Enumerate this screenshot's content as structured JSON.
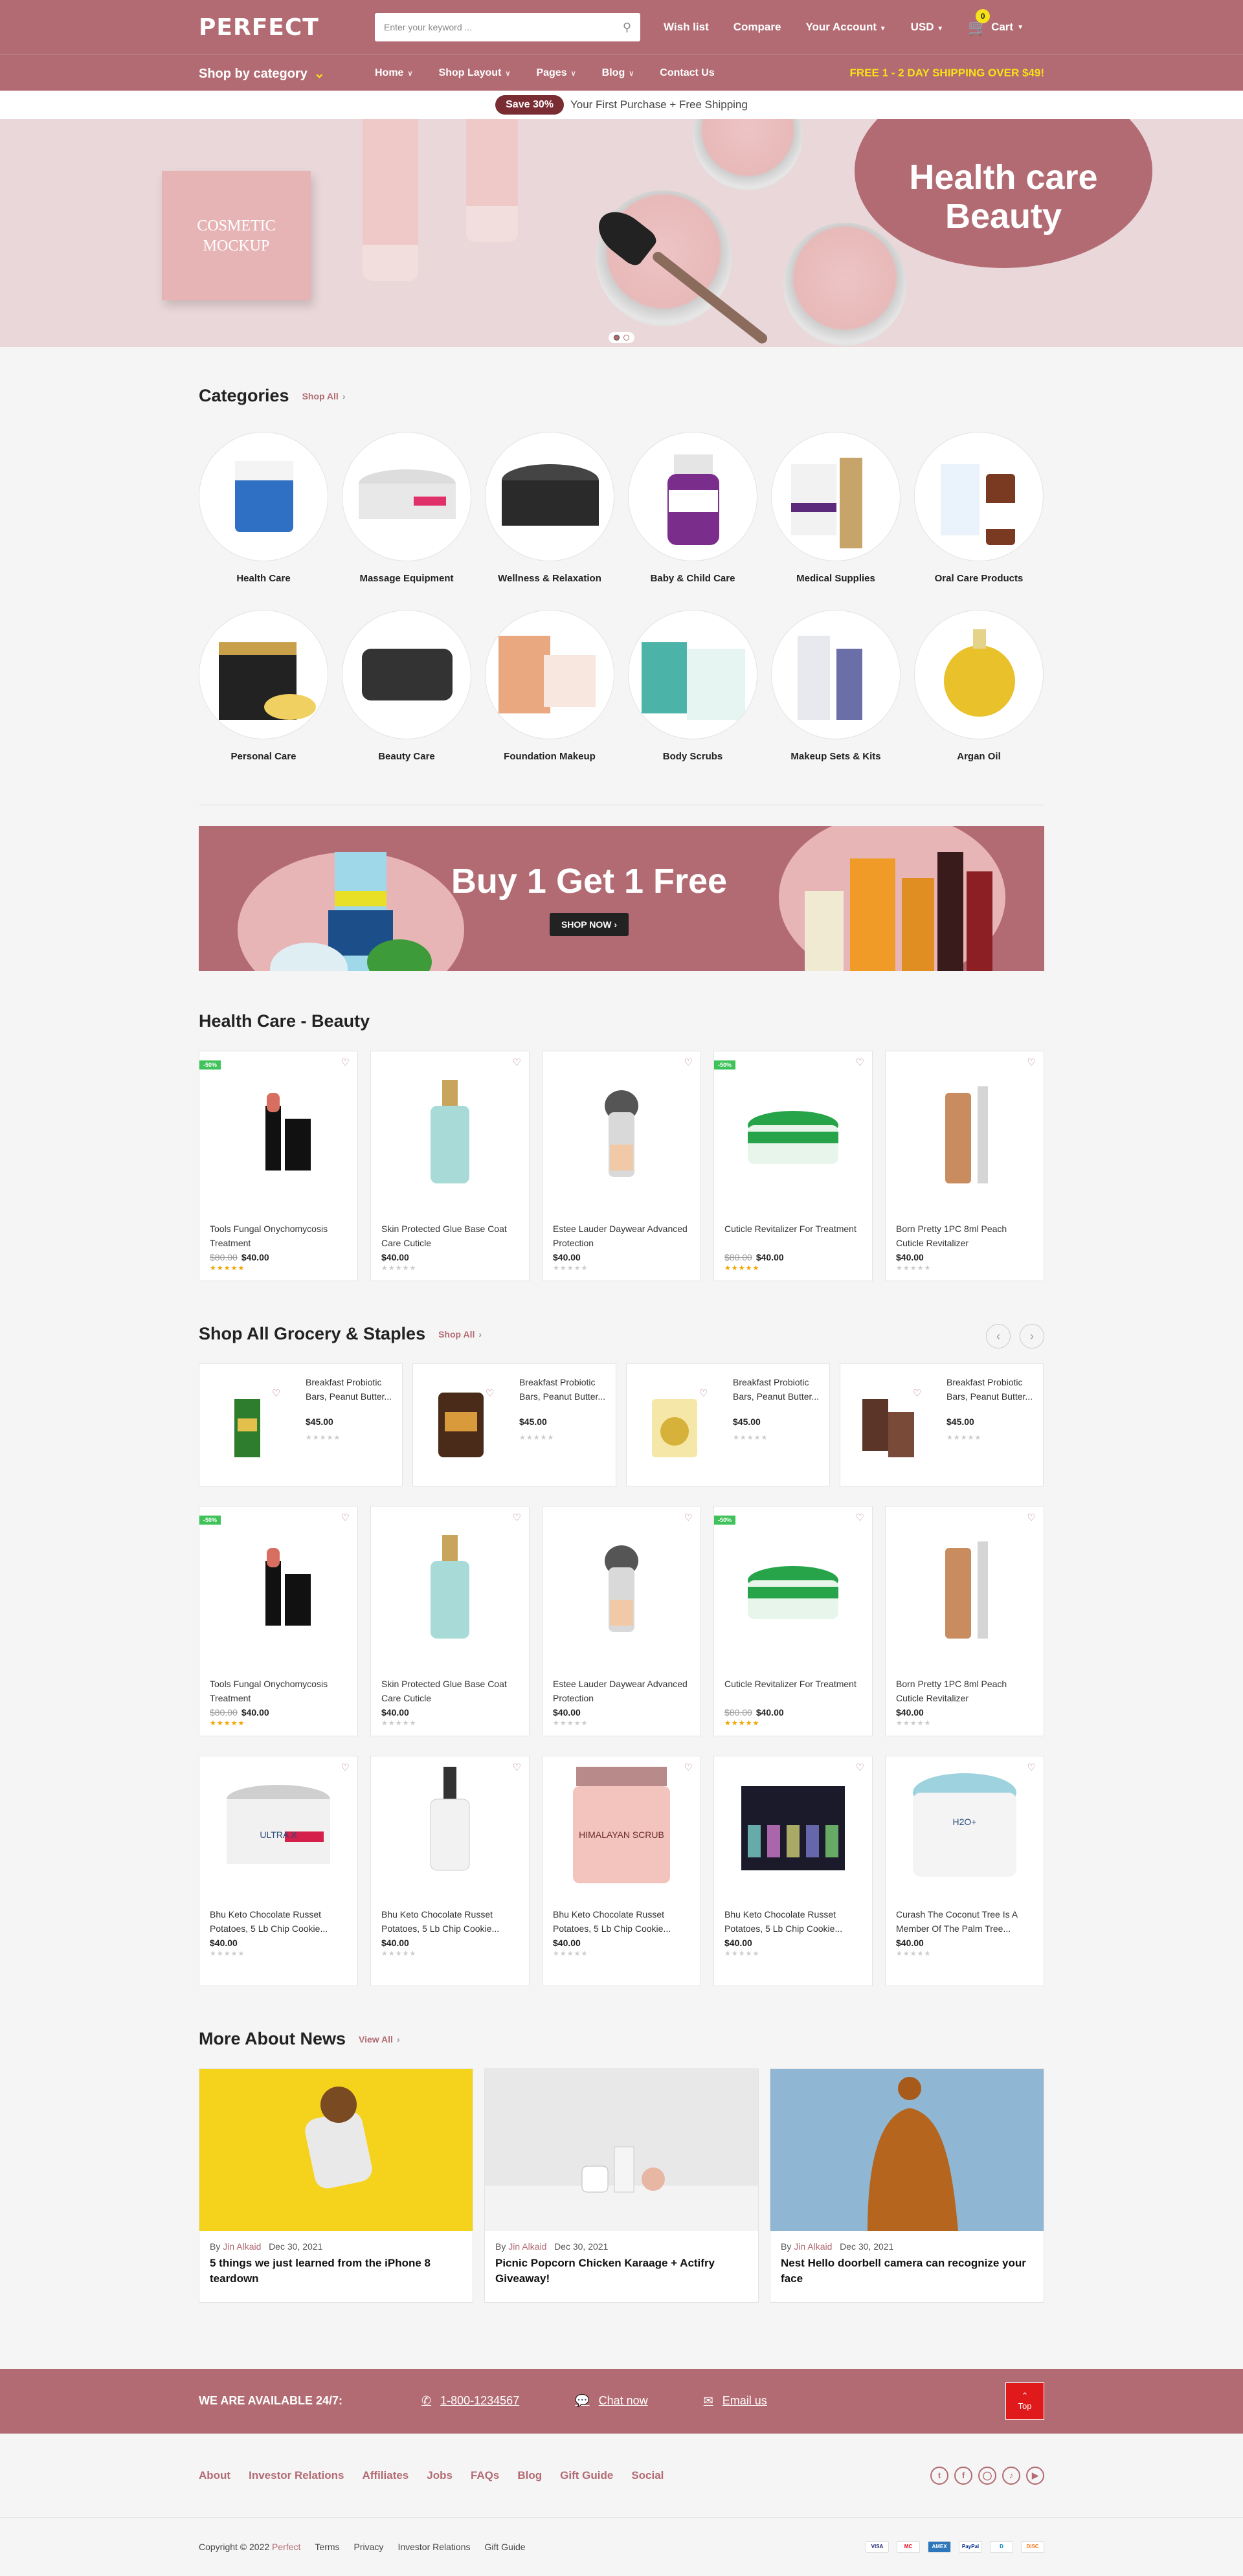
{
  "header": {
    "logo": "PERFECT",
    "search_placeholder": "Enter your keyword ...",
    "links": [
      "Wish list",
      "Compare",
      "Your Account",
      "USD",
      "Cart"
    ],
    "cart_count": "0"
  },
  "nav": {
    "shop_by_category": "Shop by category",
    "menu": [
      "Home",
      "Shop Layout",
      "Pages",
      "Blog",
      "Contact Us"
    ],
    "shipping": "FREE 1 - 2 DAY SHIPPING OVER $49!"
  },
  "promo": {
    "pill": "Save 30%",
    "text": "Your First Purchase + Free Shipping"
  },
  "hero": {
    "title_line1": "Health care",
    "title_line2": "Beauty",
    "box_text": "COSMETIC MOCKUP"
  },
  "categories": {
    "title": "Categories",
    "shop_all": "Shop All",
    "items": [
      "Health Care",
      "Massage Equipment",
      "Wellness & Relaxation",
      "Baby & Child Care",
      "Medical Supplies",
      "Oral Care Products",
      "Personal Care",
      "Beauty Care",
      "Foundation Makeup",
      "Body Scrubs",
      "Makeup Sets & Kits",
      "Argan Oil"
    ]
  },
  "banner": {
    "title": "Buy 1 Get 1 Free",
    "button": "SHOP NOW"
  },
  "health_section": {
    "title": "Health Care - Beauty",
    "products": [
      {
        "name": "Tools Fungal Onychomycosis Treatment",
        "old": "$80.00",
        "price": "$40.00",
        "sale": "-50%",
        "rated": true
      },
      {
        "name": "Skin Protected Glue Base Coat Care Cuticle",
        "old": "",
        "price": "$40.00",
        "sale": "",
        "rated": false
      },
      {
        "name": "Estee Lauder Daywear Advanced Protection",
        "old": "",
        "price": "$40.00",
        "sale": "",
        "rated": false
      },
      {
        "name": "Cuticle Revitalizer For Treatment",
        "old": "$80.00",
        "price": "$40.00",
        "sale": "-50%",
        "rated": true
      },
      {
        "name": "Born Pretty 1PC 8ml Peach Cuticle Revitalizer",
        "old": "",
        "price": "$40.00",
        "sale": "",
        "rated": false
      }
    ]
  },
  "grocery_section": {
    "title": "Shop All Grocery & Staples",
    "shop_all": "Shop All",
    "mini": [
      {
        "name": "Breakfast Probiotic Bars, Peanut Butter...",
        "price": "$45.00"
      },
      {
        "name": "Breakfast Probiotic Bars, Peanut Butter...",
        "price": "$45.00"
      },
      {
        "name": "Breakfast Probiotic Bars, Peanut Butter...",
        "price": "$45.00"
      },
      {
        "name": "Breakfast Probiotic Bars, Peanut Butter...",
        "price": "$45.00"
      }
    ],
    "row1": [
      {
        "name": "Tools Fungal Onychomycosis Treatment",
        "old": "$80.00",
        "price": "$40.00",
        "sale": "-50%",
        "rated": true
      },
      {
        "name": "Skin Protected Glue Base Coat Care Cuticle",
        "old": "",
        "price": "$40.00",
        "sale": "",
        "rated": false
      },
      {
        "name": "Estee Lauder Daywear Advanced Protection",
        "old": "",
        "price": "$40.00",
        "sale": "",
        "rated": false
      },
      {
        "name": "Cuticle Revitalizer For Treatment",
        "old": "$80.00",
        "price": "$40.00",
        "sale": "-50%",
        "rated": true
      },
      {
        "name": "Born Pretty 1PC 8ml Peach Cuticle Revitalizer",
        "old": "",
        "price": "$40.00",
        "sale": "",
        "rated": false
      }
    ],
    "row2": [
      {
        "name": "Bhu Keto Chocolate Russet Potatoes, 5 Lb Chip Cookie...",
        "price": "$40.00",
        "img_text": "ULTRA X"
      },
      {
        "name": "Bhu Keto Chocolate Russet Potatoes, 5 Lb Chip Cookie...",
        "price": "$40.00",
        "img_text": ""
      },
      {
        "name": "Bhu Keto Chocolate Russet Potatoes, 5 Lb Chip Cookie...",
        "price": "$40.00",
        "img_text": "HIMALAYAN SCRUB"
      },
      {
        "name": "Bhu Keto Chocolate Russet Potatoes, 5 Lb Chip Cookie...",
        "price": "$40.00",
        "img_text": ""
      },
      {
        "name": "Curash The Coconut Tree Is A Member Of The Palm Tree...",
        "price": "$40.00",
        "img_text": "H2O+"
      }
    ]
  },
  "news": {
    "title": "More About News",
    "view_all": "View All",
    "items": [
      {
        "by": "By",
        "author": "Jin Alkaid",
        "date": "Dec 30, 2021",
        "title": "5 things we just learned from the iPhone 8 teardown"
      },
      {
        "by": "By",
        "author": "Jin Alkaid",
        "date": "Dec 30, 2021",
        "title": "Picnic Popcorn Chicken Karaage + Actifry Giveaway!"
      },
      {
        "by": "By",
        "author": "Jin Alkaid",
        "date": "Dec 30, 2021",
        "title": "Nest Hello doorbell camera can recognize your face"
      }
    ]
  },
  "footer": {
    "available": "WE ARE AVAILABLE 24/7:",
    "phone": "1-800-1234567",
    "chat": "Chat now",
    "email": "Email us",
    "top": "Top",
    "links": [
      "About",
      "Investor Relations",
      "Affiliates",
      "Jobs",
      "FAQs",
      "Blog",
      "Gift Guide",
      "Social"
    ],
    "copyright": "Copyright © 2022",
    "brand": "Perfect",
    "bottom_links": [
      "Terms",
      "Privacy",
      "Investor Relations",
      "Gift Guide"
    ],
    "payments": [
      "VISA",
      "MC",
      "AMEX",
      "PayPal",
      "D",
      "DISC"
    ]
  },
  "colors": {
    "brand": "#b26b73",
    "accent": "#f7e118",
    "sale": "#3fc25a"
  }
}
